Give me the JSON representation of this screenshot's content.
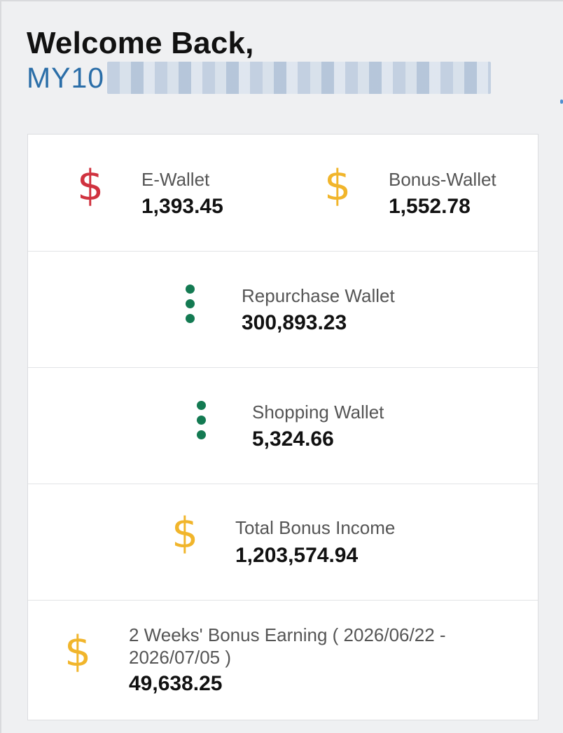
{
  "header": {
    "welcome": "Welcome Back,",
    "username_visible": "MY10"
  },
  "wallets": {
    "ewallet": {
      "label": "E-Wallet",
      "value": "1,393.45",
      "icon": "dollar-icon",
      "color": "#d0323f"
    },
    "bonus_wallet": {
      "label": "Bonus-Wallet",
      "value": "1,552.78",
      "icon": "dollar-icon",
      "color": "#f1b52b"
    },
    "repurchase_wallet": {
      "label": "Repurchase Wallet",
      "value": "300,893.23",
      "icon": "vertical-dots-icon",
      "color": "#137a52"
    },
    "shopping_wallet": {
      "label": "Shopping Wallet",
      "value": "5,324.66",
      "icon": "vertical-dots-icon",
      "color": "#137a52"
    },
    "total_bonus_income": {
      "label": "Total Bonus Income",
      "value": "1,203,574.94",
      "icon": "dollar-icon",
      "color": "#f1b52b"
    },
    "two_weeks_bonus": {
      "label_line1": "2 Weeks' Bonus Earning ( 2026/06/22 -",
      "label_line2": "2026/07/05 )",
      "value": "49,638.25",
      "icon": "dollar-icon",
      "color": "#f1b52b"
    }
  }
}
